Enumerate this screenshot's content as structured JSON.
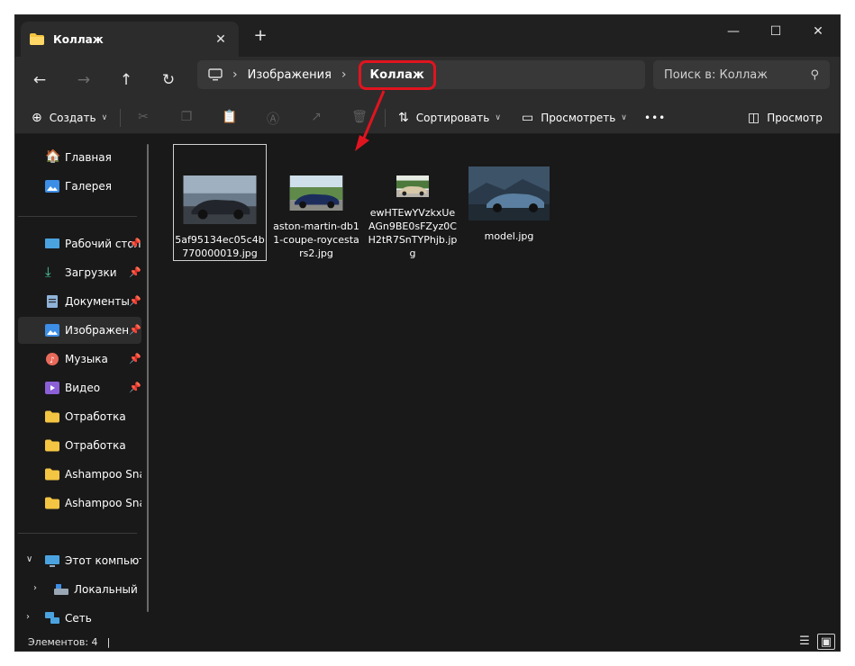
{
  "tab": {
    "title": "Коллаж"
  },
  "window": {
    "new_tab": "+",
    "minimize": "—",
    "maximize": "☐",
    "close": "✕"
  },
  "address": {
    "crumbs": [
      "Изображения"
    ],
    "current": "Коллаж",
    "search_placeholder": "Поиск в: Коллаж"
  },
  "commands": {
    "create": "Создать",
    "sort": "Сортировать",
    "view": "Просмотреть",
    "more": "•••",
    "preview": "Просмотр"
  },
  "sidebar": {
    "items": [
      {
        "label": "Главная",
        "icon": "home-icon"
      },
      {
        "label": "Галерея",
        "icon": "gallery-icon"
      },
      {
        "label": "Рабочий стол",
        "icon": "desktop-icon",
        "pinned": true
      },
      {
        "label": "Загрузки",
        "icon": "download-icon",
        "pinned": true
      },
      {
        "label": "Документы",
        "icon": "documents-icon",
        "pinned": true
      },
      {
        "label": "Изображения",
        "icon": "pictures-icon",
        "pinned": true,
        "selected": true
      },
      {
        "label": "Музыка",
        "icon": "music-icon",
        "pinned": true
      },
      {
        "label": "Видео",
        "icon": "video-icon",
        "pinned": true
      },
      {
        "label": "Отработка",
        "icon": "folder-icon"
      },
      {
        "label": "Отработка",
        "icon": "folder-icon"
      },
      {
        "label": "Ashampoo Snap",
        "icon": "folder-icon"
      },
      {
        "label": "Ashampoo Snap",
        "icon": "folder-icon"
      },
      {
        "label": "Этот компьютер",
        "icon": "computer-icon"
      },
      {
        "label": "Локальный диск",
        "icon": "drive-icon"
      },
      {
        "label": "Сеть",
        "icon": "network-icon"
      }
    ]
  },
  "files": [
    {
      "name": "5af95134ec05c4b770000019.jpg",
      "selected": true
    },
    {
      "name": "aston-martin-db11-coupe-roycestars2.jpg"
    },
    {
      "name": "ewHTEwYVzkxUeAGn9BE0sFZyz0CH2tR7SnTYPhjb.jpg"
    },
    {
      "name": "model.jpg"
    }
  ],
  "status": {
    "count": "Элементов: 4",
    "cursor": "|"
  },
  "colors": {
    "highlight": "#e0141f",
    "folder": "#f4c542",
    "bg": "#191919"
  }
}
